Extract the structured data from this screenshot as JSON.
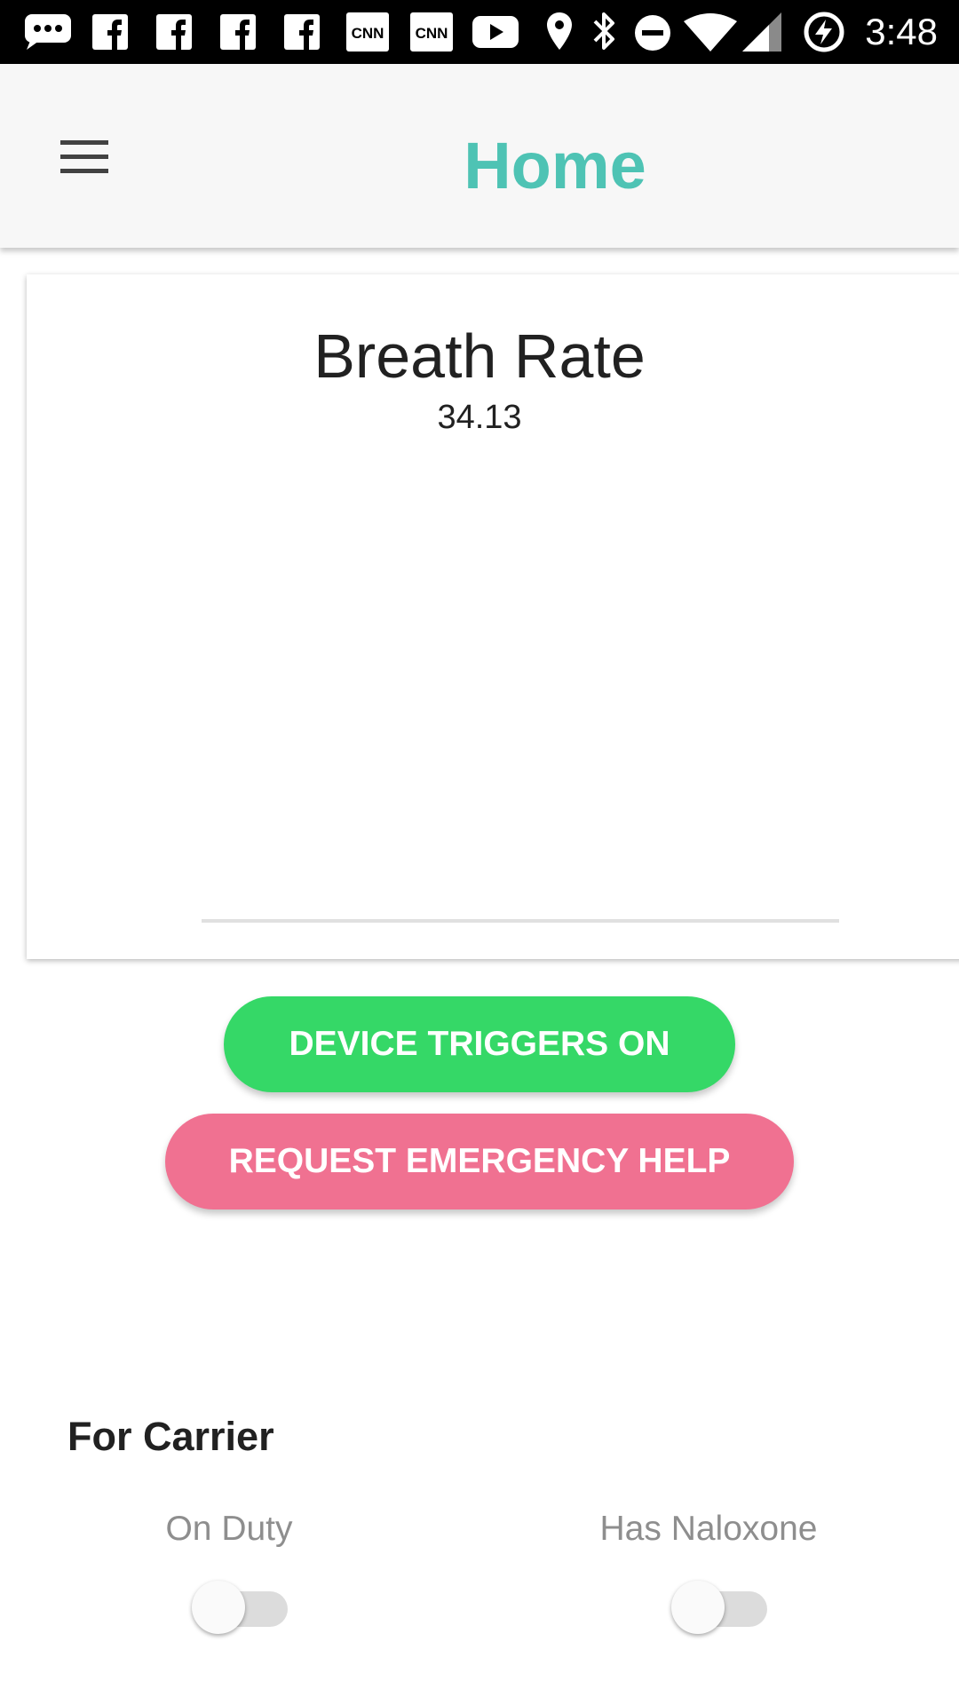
{
  "status_bar": {
    "time": "3:48",
    "icons": [
      "messaging-icon",
      "facebook-icon",
      "facebook-icon",
      "facebook-icon",
      "facebook-icon",
      "cnn-icon",
      "cnn-icon",
      "youtube-icon",
      "location-icon",
      "bluetooth-icon",
      "do-not-disturb-icon",
      "wifi-icon",
      "cell-signal-icon",
      "battery-charging-icon"
    ],
    "cnn_label": "CNN"
  },
  "app_bar": {
    "menu_icon": "hamburger-menu-icon",
    "title": "Home"
  },
  "card": {
    "title": "Breath Rate",
    "value": "34.13"
  },
  "buttons": {
    "device_triggers": "DEVICE TRIGGERS ON",
    "emergency": "REQUEST EMERGENCY HELP"
  },
  "carrier": {
    "section_title": "For Carrier",
    "toggles": [
      {
        "label": "On Duty",
        "on": false
      },
      {
        "label": "Has Naloxone",
        "on": false
      }
    ]
  },
  "colors": {
    "accent_title": "#4ec3b4",
    "triggers_button": "#35d867",
    "emergency_button": "#f07191",
    "status_bar": "#000000",
    "app_bar": "#f7f7f7"
  }
}
